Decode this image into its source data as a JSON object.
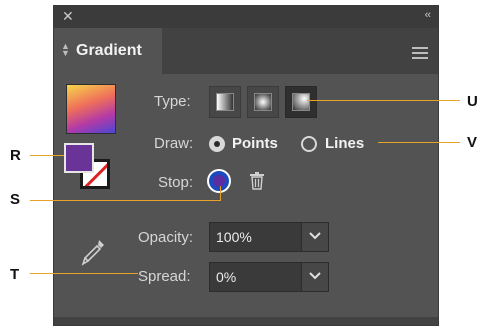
{
  "panel": {
    "tab_label": "Gradient",
    "type_label": "Type:",
    "draw_label": "Draw:",
    "draw_options": [
      "Points",
      "Lines"
    ],
    "draw_selected": "Points",
    "stop_label": "Stop:",
    "opacity_label": "Opacity:",
    "opacity_value": "100%",
    "spread_label": "Spread:",
    "spread_value": "0%",
    "type_options": [
      "linear",
      "radial",
      "freeform"
    ],
    "type_selected": "freeform"
  },
  "callouts": {
    "U": "U",
    "V": "V",
    "R": "R",
    "S": "S",
    "T": "T"
  },
  "colors": {
    "callout_line": "#e8a22a",
    "panel_bg": "#535353",
    "fill_swatch": "#6a3398",
    "stop_fill": "#5a2da0"
  }
}
